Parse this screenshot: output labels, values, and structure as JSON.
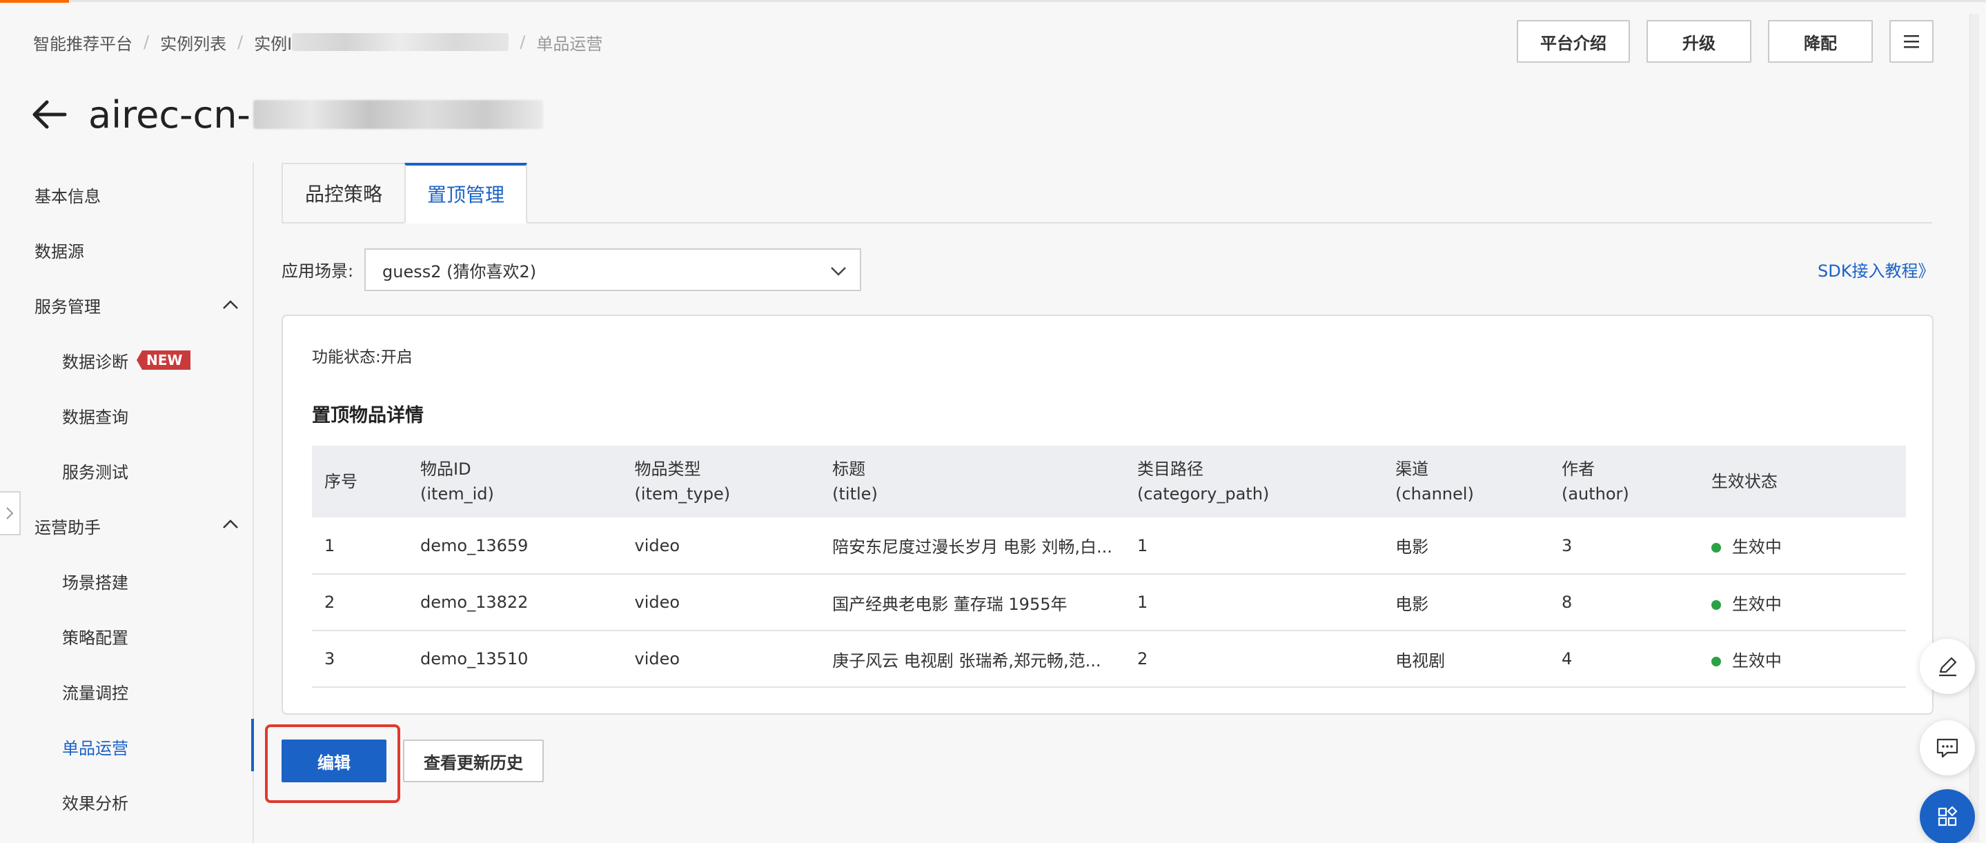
{
  "breadcrumb": {
    "items": [
      "智能推荐平台",
      "实例列表",
      "实例I"
    ],
    "current": "单品运营"
  },
  "header_buttons": {
    "intro": "平台介绍",
    "upgrade": "升级",
    "downgrade": "降配",
    "menu_icon": "menu-icon"
  },
  "title": "airec-cn-",
  "sidebar": {
    "items": [
      {
        "label": "基本信息"
      },
      {
        "label": "数据源"
      },
      {
        "label": "服务管理"
      },
      {
        "label": "数据诊断",
        "badge": "NEW"
      },
      {
        "label": "数据查询"
      },
      {
        "label": "服务测试"
      },
      {
        "label": "运营助手"
      },
      {
        "label": "场景搭建"
      },
      {
        "label": "策略配置"
      },
      {
        "label": "流量调控"
      },
      {
        "label": "单品运营"
      },
      {
        "label": "效果分析"
      }
    ]
  },
  "tabs": [
    {
      "label": "品控策略"
    },
    {
      "label": "置顶管理"
    }
  ],
  "scene": {
    "label": "应用场景:",
    "value": "guess2 (猜你喜欢2)"
  },
  "sdk_link": "SDK接入教程》",
  "panel": {
    "func_status": "功能状态:开启",
    "detail_title": "置顶物品详情"
  },
  "table": {
    "headers": [
      [
        "序号",
        ""
      ],
      [
        "物品ID",
        "(item_id)"
      ],
      [
        "物品类型",
        "(item_type)"
      ],
      [
        "标题",
        "(title)"
      ],
      [
        "类目路径",
        "(category_path)"
      ],
      [
        "渠道",
        "(channel)"
      ],
      [
        "作者",
        "(author)"
      ],
      [
        "生效状态",
        ""
      ]
    ],
    "rows": [
      [
        "1",
        "demo_13659",
        "video",
        "陪安东尼度过漫长岁月 电影 刘畅,白...",
        "1",
        "电影",
        "3",
        "生效中"
      ],
      [
        "2",
        "demo_13822",
        "video",
        "国产经典老电影 董存瑞 1955年",
        "1",
        "电影",
        "8",
        "生效中"
      ],
      [
        "3",
        "demo_13510",
        "video",
        "庚子风云 电视剧 张瑞希,郑元畅,范...",
        "2",
        "电视剧",
        "4",
        "生效中"
      ]
    ],
    "status_color": "#2ba245"
  },
  "buttons": {
    "edit": "编辑",
    "history": "查看更新历史"
  },
  "colors": {
    "accent": "#1a62c6",
    "highlight": "#e03a2d",
    "badge": "#c93b3b"
  }
}
